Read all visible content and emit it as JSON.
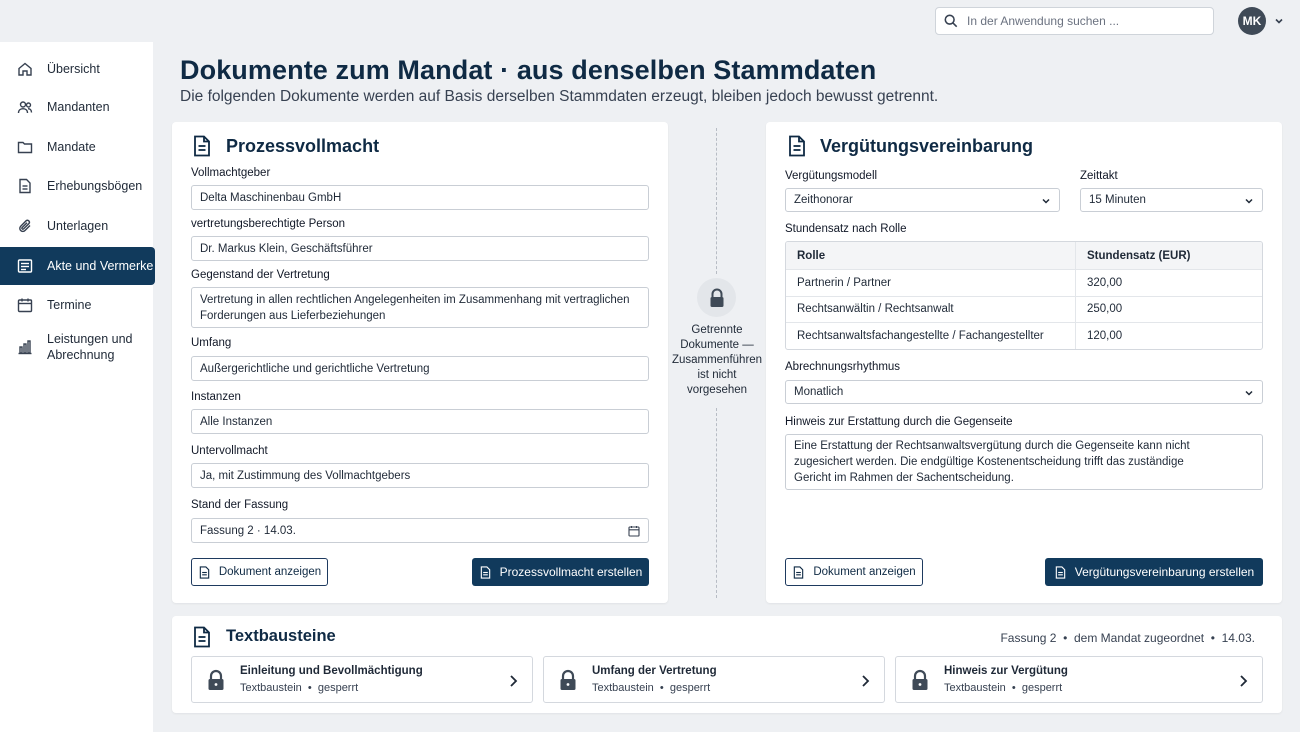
{
  "header": {
    "search_placeholder": "In der Anwendung suchen ...",
    "user_initials": "MK"
  },
  "sidebar": {
    "items": [
      {
        "label": "Übersicht",
        "icon": "home-icon"
      },
      {
        "label": "Mandanten",
        "icon": "users-icon"
      },
      {
        "label": "Mandate",
        "icon": "folder-icon"
      },
      {
        "label": "Erhebungsbögen",
        "icon": "document-icon"
      },
      {
        "label": "Unterlagen",
        "icon": "paperclip-icon"
      },
      {
        "label": "Akte und Vermerke",
        "icon": "list-icon",
        "active": true
      },
      {
        "label": "Termine",
        "icon": "calendar-icon"
      },
      {
        "label": "Leistungen und Abrechnung",
        "icon": "bar-chart-icon"
      }
    ]
  },
  "page": {
    "title": "Dokumente zum Mandat · aus denselben Stammdaten",
    "subtitle": "Die folgenden Dokumente werden auf Basis derselben Stammdaten erzeugt, bleiben jedoch bewusst getrennt."
  },
  "prozessvollmacht": {
    "title": "Prozessvollmacht",
    "fields": {
      "vollmachtgeber": {
        "label": "Vollmachtgeber",
        "value": "Delta Maschinenbau GmbH"
      },
      "person": {
        "label": "vertretungsberechtigte Person",
        "value": "Dr. Markus Klein, Geschäftsführer"
      },
      "gegenstand": {
        "label": "Gegenstand der Vertretung",
        "value": "Vertretung in allen rechtlichen Angelegenheiten im Zusammenhang mit vertraglichen Forderungen aus Lieferbeziehungen"
      },
      "umfang": {
        "label": "Umfang",
        "value": "Außergerichtliche und gerichtliche Vertretung"
      },
      "instanzen": {
        "label": "Instanzen",
        "value": "Alle Instanzen"
      },
      "untervollmacht": {
        "label": "Untervollmacht",
        "value": "Ja, mit Zustimmung des Vollmachtgebers"
      },
      "stand": {
        "label": "Stand der Fassung",
        "value": "Fassung 2 · 14.03."
      }
    },
    "btn_view": "Dokument anzeigen",
    "btn_create": "Prozessvollmacht erstellen"
  },
  "separator": {
    "text": "Getrennte Dokumente — Zusammenführen ist nicht vorgesehen"
  },
  "verguetung": {
    "title": "Vergütungsvereinbarung",
    "model": {
      "label": "Vergütungsmodell",
      "value": "Zeithonorar"
    },
    "zeittakt": {
      "label": "Zeittakt",
      "value": "15 Minuten"
    },
    "rates_label": "Stundensatz nach Rolle",
    "rates_header": {
      "role": "Rolle",
      "rate": "Stundensatz (EUR)"
    },
    "rates": [
      {
        "role": "Partnerin / Partner",
        "rate": "320,00"
      },
      {
        "role": "Rechtsanwältin / Rechtsanwalt",
        "rate": "250,00"
      },
      {
        "role": "Rechtsanwaltsfachangestellte / Fachangestellter",
        "rate": "120,00"
      }
    ],
    "rhythmus": {
      "label": "Abrechnungsrhythmus",
      "value": "Monatlich"
    },
    "hinweis": {
      "label": "Hinweis zur Erstattung durch die Gegenseite",
      "value": "Eine Erstattung der Rechtsanwaltsvergütung durch die Gegenseite kann nicht zugesichert werden. Die endgültige Kostenentscheidung trifft das zuständige Gericht im Rahmen der Sachentscheidung."
    },
    "btn_view": "Dokument anzeigen",
    "btn_create": "Vergütungsvereinbarung erstellen"
  },
  "textbausteine": {
    "title": "Textbausteine",
    "meta": "Fassung 2  •  dem Mandat zugeordnet  •  14.03.",
    "tiles": [
      {
        "name": "Einleitung und Bevollmächtigung",
        "sub": "Textbaustein  •  gesperrt"
      },
      {
        "name": "Umfang der Vertretung",
        "sub": "Textbaustein  •  gesperrt"
      },
      {
        "name": "Hinweis zur Vergütung",
        "sub": "Textbaustein  •  gesperrt"
      }
    ]
  },
  "colors": {
    "primary": "#113a5c",
    "title": "#0f2a44",
    "background": "#eef0f3"
  }
}
